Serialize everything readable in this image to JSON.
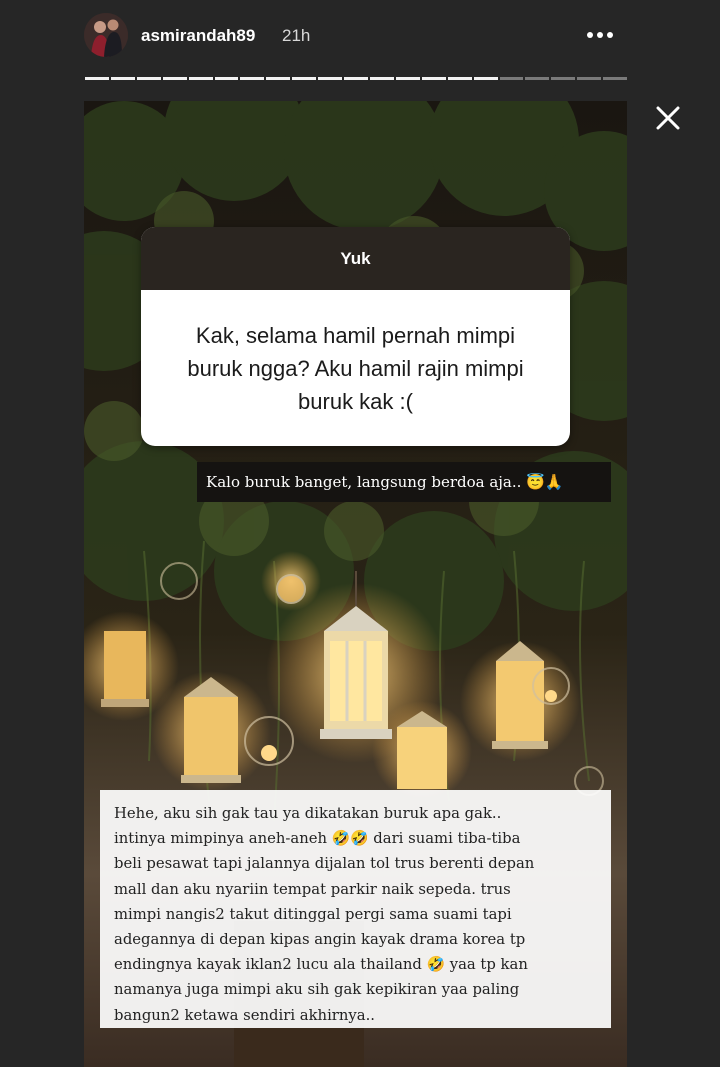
{
  "header": {
    "username": "asmirandah89",
    "timestamp": "21h"
  },
  "progress": {
    "segments_total": 21,
    "segments_viewed": 16
  },
  "question_sticker": {
    "prompt": "Yuk",
    "text": "Kak, selama hamil pernah mimpi buruk ngga? Aku hamil rajin mimpi buruk kak :("
  },
  "answer_caption": {
    "text": "Kalo buruk banget, langsung berdoa aja.. 😇🙏"
  },
  "reply": {
    "lines": [
      "Hehe, aku sih gak tau ya dikatakan buruk apa gak..",
      "intinya mimpinya aneh-aneh 🤣🤣 dari suami tiba-tiba",
      "beli pesawat tapi jalannya dijalan tol trus berenti depan",
      "mall dan aku nyariin tempat parkir naik sepeda. trus",
      "mimpi nangis2 takut ditinggal pergi sama suami tapi",
      "adegannya di depan kipas angin kayak drama korea tp",
      "endingnya kayak iklan2 lucu ala thailand 🤣 yaa tp kan",
      "namanya juga mimpi aku sih gak kepikiran yaa paling",
      "bangun2 ketawa sendiri akhirnya.."
    ]
  },
  "icons": {
    "more": "more-horizontal-icon",
    "close": "close-icon"
  },
  "colors": {
    "background": "#262626",
    "text_primary": "#ffffff",
    "question_header": "#2a2520",
    "caption_bg": "#151311"
  }
}
